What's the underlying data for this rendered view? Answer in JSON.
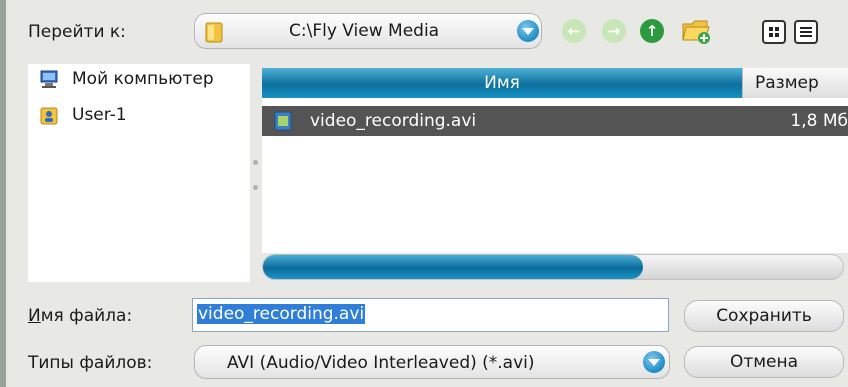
{
  "toolbar": {
    "goto_label": "Перейти к:",
    "path_value": "C:\\Fly View Media",
    "icons": [
      "back-icon",
      "forward-icon",
      "up-icon",
      "new-folder-icon",
      "icon-view-icon",
      "list-view-icon"
    ]
  },
  "tree": {
    "items": [
      {
        "label": "Мой компьютер",
        "icon": "computer-icon"
      },
      {
        "label": "User-1",
        "icon": "user-folder-icon"
      }
    ]
  },
  "file_list": {
    "columns": [
      "Имя",
      "Размер"
    ],
    "rows": [
      {
        "name": "video_recording.avi",
        "size": "1,8 Мб"
      }
    ]
  },
  "form": {
    "filename_label_underlined": "И",
    "filename_label_rest": "мя файла:",
    "filename_value": "video_recording.avi",
    "filetype_label": "Типы файлов:",
    "filetype_value": "AVI (Audio/Video Interleaved) (*.avi)"
  },
  "buttons": {
    "save": "Сохранить",
    "cancel": "Отмена"
  },
  "colors": {
    "accent": "#1593c4",
    "selection": "#545454",
    "text_selection": "#2f7fd8"
  }
}
